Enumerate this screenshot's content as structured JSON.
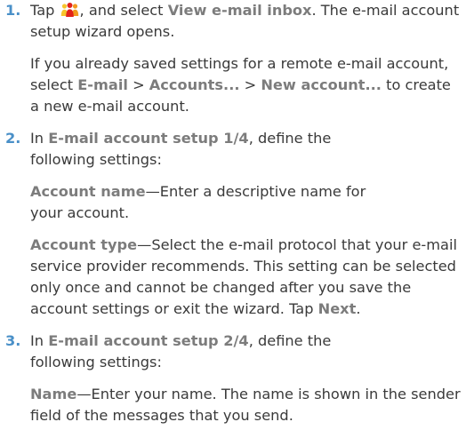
{
  "colors": {
    "step_number": "#4a90c8",
    "keyword": "#7c7c7c",
    "body_text": "#3a3a3a",
    "icon_orange": "#f29a1e",
    "icon_red": "#e2231a",
    "icon_yellow": "#f7c52b"
  },
  "icons": {
    "contacts": "people-group-icon"
  },
  "steps": [
    {
      "number": "1.",
      "p1": {
        "t1": "Tap ",
        "t2": ", and select ",
        "k1": "View e-mail inbox",
        "t3": ". The e-mail account setup wizard opens."
      },
      "p2": {
        "t1": "If you already saved settings for a remote e-mail account, select ",
        "k1": "E-mail",
        "t2": " > ",
        "k2": "Accounts...",
        "t3": " > ",
        "k3": "New account...",
        "t4": " to create a new e-mail account."
      }
    },
    {
      "number": "2.",
      "p1": {
        "t1": "In ",
        "k1": "E-mail account setup 1/4",
        "t2": ", define the following settings:"
      },
      "p2": {
        "k1": "Account name",
        "t1": "—Enter a descriptive name for your account."
      },
      "p3": {
        "k1": "Account type",
        "t1": "—Select the e-mail protocol that your e-mail service provider recommends. This setting can be selected only once and cannot be changed after you save the account settings or exit the wizard. Tap ",
        "k2": "Next",
        "t2": "."
      }
    },
    {
      "number": "3.",
      "p1": {
        "t1": "In ",
        "k1": "E-mail account setup 2/4",
        "t2": ", define the following settings:"
      },
      "p2": {
        "k1": "Name",
        "t1": "—Enter your name. The name is shown in the sender field of the messages that you send."
      }
    }
  ]
}
